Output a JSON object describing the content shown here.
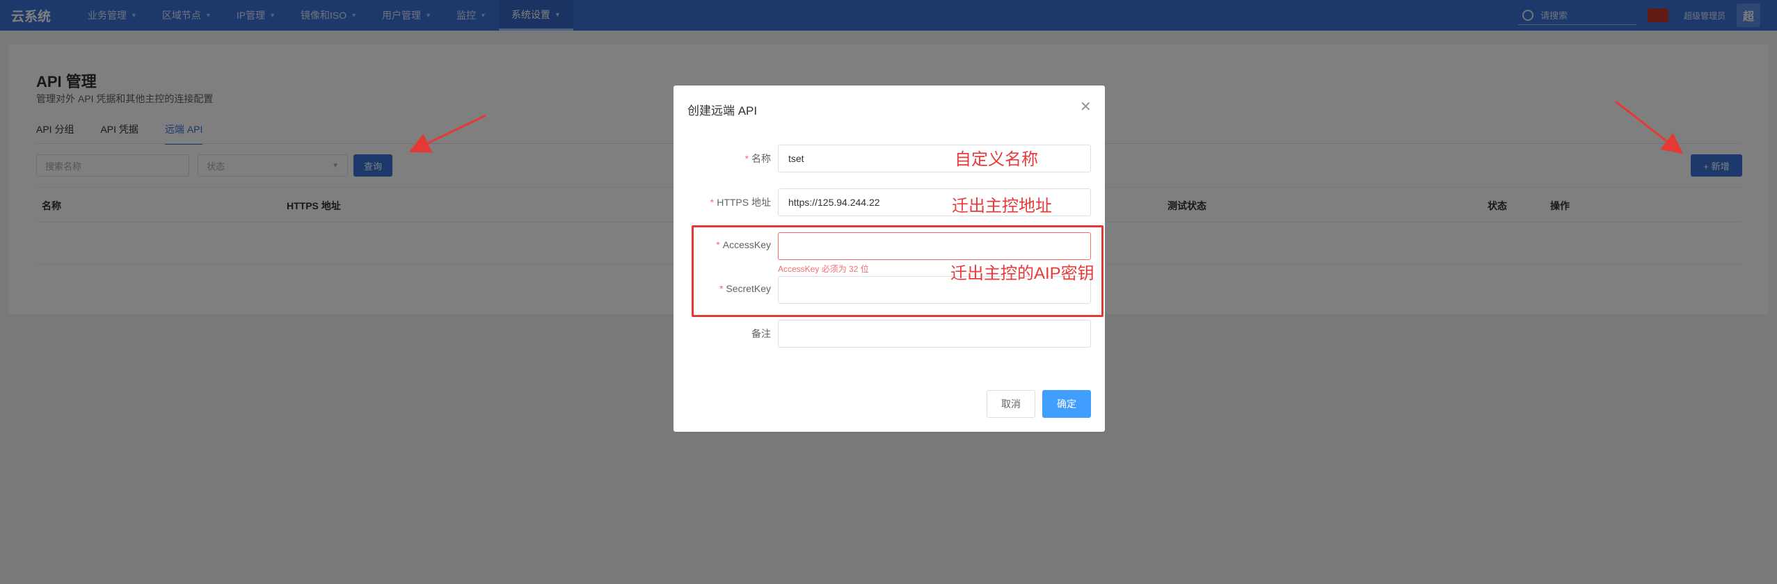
{
  "app": {
    "logo": "云系统"
  },
  "nav": [
    {
      "label": "业务管理"
    },
    {
      "label": "区域节点"
    },
    {
      "label": "IP管理"
    },
    {
      "label": "镜像和ISO"
    },
    {
      "label": "用户管理"
    },
    {
      "label": "监控"
    },
    {
      "label": "系统设置",
      "active": true
    }
  ],
  "header": {
    "search_placeholder": "请搜索",
    "user_name": "超级管理员",
    "avatar_text": "超"
  },
  "page": {
    "title": "API 管理",
    "subtitle": "管理对外 API 凭据和其他主控的连接配置",
    "tabs": [
      {
        "label": "API 分组"
      },
      {
        "label": "API 凭据"
      },
      {
        "label": "远端 API",
        "active": true
      }
    ],
    "filters": {
      "name_placeholder": "搜索名称",
      "status_placeholder": "状态",
      "query_label": "查询"
    },
    "add_label": "+ 新增",
    "table_columns": [
      "名称",
      "HTTPS 地址",
      "测试状态",
      "状态",
      "操作"
    ]
  },
  "dialog": {
    "title": "创建远端 API",
    "fields": {
      "name": {
        "label": "名称",
        "value": "tset",
        "required": true
      },
      "https": {
        "label": "HTTPS 地址",
        "value": "https://125.94.244.22",
        "required": true
      },
      "access_key": {
        "label": "AccessKey",
        "value": "",
        "required": true,
        "error": "AccessKey 必须为 32 位"
      },
      "secret_key": {
        "label": "SecretKey",
        "value": "",
        "required": true
      },
      "remark": {
        "label": "备注",
        "value": ""
      }
    },
    "cancel_label": "取消",
    "ok_label": "确定"
  },
  "annotations": {
    "name_note": "自定义名称",
    "https_note": "迁出主控地址",
    "key_note": "迁出主控的AIP密钥"
  },
  "colors": {
    "primary": "#3b72d9",
    "annotation": "#e83a3a",
    "error": "#f56c6c"
  }
}
